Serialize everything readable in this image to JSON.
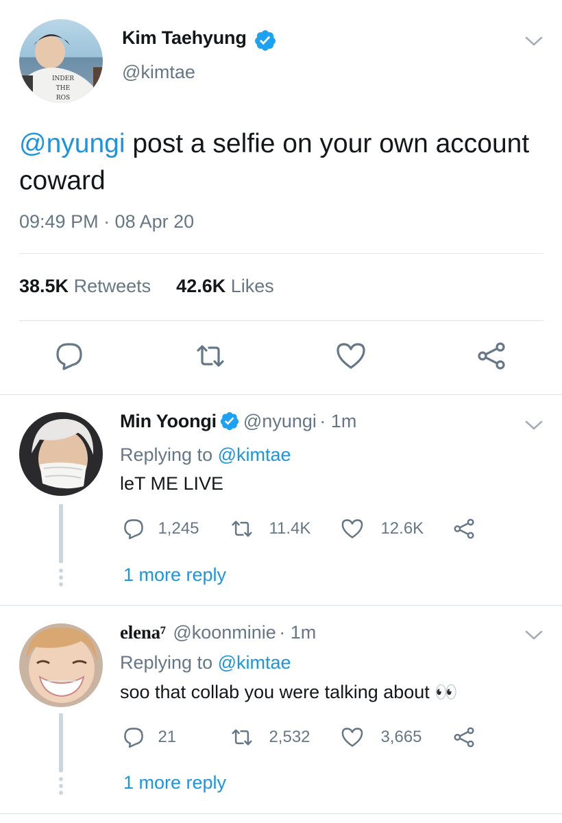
{
  "main_tweet": {
    "display_name": "Kim Taehyung",
    "handle": "@kimtae",
    "mention": "@nyungi",
    "text": " post a selfie on your own account coward",
    "timestamp": "09:49 PM · 08 Apr 20",
    "retweets_count": "38.5K",
    "retweets_label": "Retweets",
    "likes_count": "42.6K",
    "likes_label": "Likes",
    "avatar_shirt_text": "INDER THE ROS"
  },
  "replies": [
    {
      "display_name": "Min Yoongi",
      "handle": "@nyungi",
      "time": "· 1m",
      "replying_prefix": "Replying to",
      "replying_to": "@kimtae",
      "text": "leT ME LIVE",
      "reply_count": "1,245",
      "retweet_count": "11.4K",
      "like_count": "12.6K",
      "more_replies": "1 more reply"
    },
    {
      "display_name": "elena⁷",
      "handle": "@koonminie",
      "time": "· 1m",
      "replying_prefix": "Replying to",
      "replying_to": "@kimtae",
      "text": "soo that collab you were talking about 👀",
      "reply_count": "21",
      "retweet_count": "2,532",
      "like_count": "3,665",
      "more_replies": "1 more reply"
    }
  ],
  "icons": {
    "verified": "verified-badge-icon",
    "chevron": "chevron-down-icon",
    "reply": "reply-icon",
    "retweet": "retweet-icon",
    "like": "heart-icon",
    "share": "share-icon"
  },
  "colors": {
    "accent": "#1b95e0",
    "muted": "#657786",
    "icon_gray": "#657786",
    "divider": "#e1e8ed"
  }
}
